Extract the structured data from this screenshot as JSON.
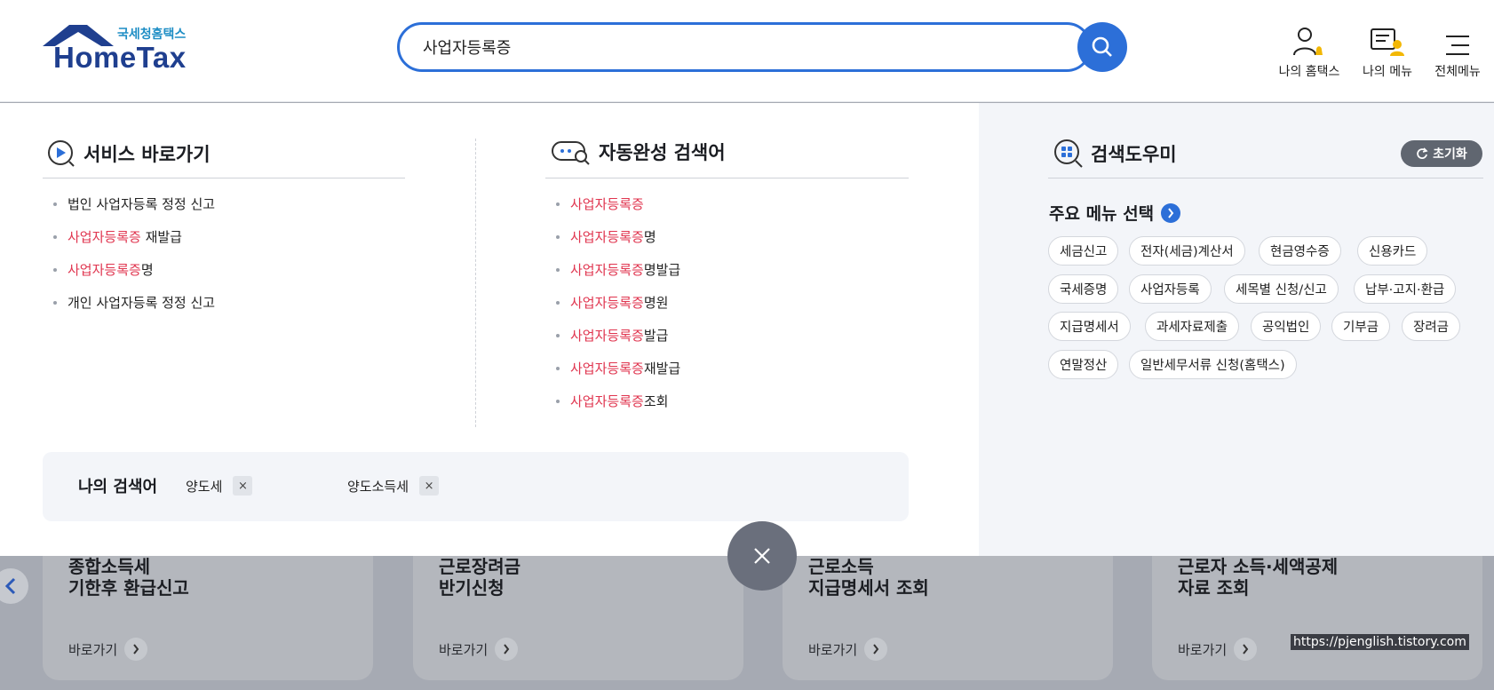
{
  "header": {
    "logo_sub": "국세청홈택스",
    "logo_main": "HomeTax",
    "search_value": "사업자등록증",
    "links": [
      "나의 홈택스",
      "나의 메뉴",
      "전체메뉴"
    ]
  },
  "service": {
    "title": "서비스 바로가기",
    "items": [
      {
        "hl": "",
        "rest": "법인 사업자등록 정정 신고"
      },
      {
        "hl": "사업자등록증",
        "rest": " 재발급"
      },
      {
        "hl": "사업자등록증",
        "rest": "명"
      },
      {
        "hl": "",
        "rest": "개인 사업자등록 정정 신고"
      }
    ]
  },
  "autocomplete": {
    "title": "자동완성 검색어",
    "items": [
      {
        "hl": "사업자등록증",
        "rest": ""
      },
      {
        "hl": "사업자등록증",
        "rest": "명"
      },
      {
        "hl": "사업자등록증",
        "rest": "명발급"
      },
      {
        "hl": "사업자등록증",
        "rest": "명원"
      },
      {
        "hl": "사업자등록증",
        "rest": "발급"
      },
      {
        "hl": "사업자등록증",
        "rest": "재발급"
      },
      {
        "hl": "사업자등록증",
        "rest": "조회"
      }
    ]
  },
  "my_search": {
    "label": "나의 검색어",
    "items": [
      "양도세",
      "양도소득세"
    ],
    "remove_glyph": "×"
  },
  "helper": {
    "title": "검색도우미",
    "reset_label": "초기화",
    "menu_title": "주요 메뉴 선택",
    "tags": [
      "세금신고",
      "전자(세금)계산서",
      "현금영수증",
      "신용카드",
      "국세증명",
      "사업자등록",
      "세목별 신청/신고",
      "납부·고지·환급",
      "지급명세서",
      "과세자료제출",
      "공익법인",
      "기부금",
      "장려금",
      "연말정산",
      "일반세무서류 신청(홈택스)"
    ]
  },
  "cards": [
    {
      "title": "종합소득세\n기한후 환급신고",
      "go": "바로가기"
    },
    {
      "title": "근로장려금\n반기신청",
      "go": "바로가기"
    },
    {
      "title": "근로소득\n지급명세서 조회",
      "go": "바로가기"
    },
    {
      "title": "근로자 소득·세액공제\n자료 조회",
      "go": "바로가기"
    }
  ],
  "watermark": "https://pjenglish.tistory.com",
  "colors": {
    "accent": "#2c6fd8",
    "highlight": "#e0354f",
    "logo": "#1f3f8f"
  }
}
